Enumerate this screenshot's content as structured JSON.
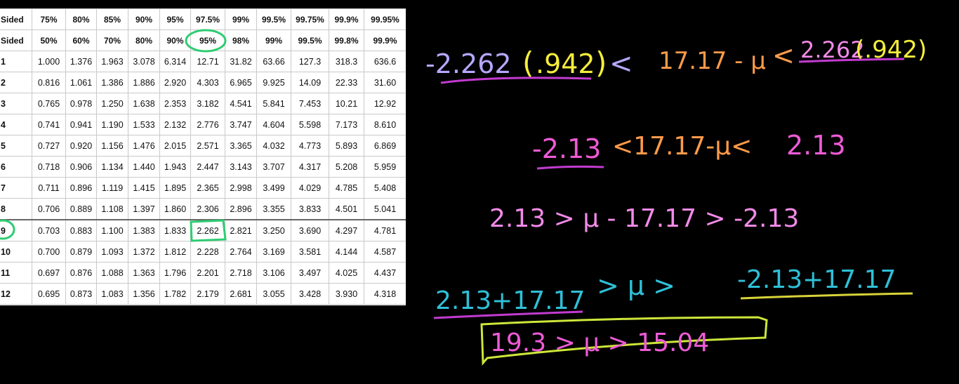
{
  "t_table": {
    "one_sided_label": "Sided",
    "two_sided_label": "Sided",
    "one_sided": [
      "75%",
      "80%",
      "85%",
      "90%",
      "95%",
      "97.5%",
      "99%",
      "99.5%",
      "99.75%",
      "99.9%",
      "99.95%"
    ],
    "two_sided": [
      "50%",
      "60%",
      "70%",
      "80%",
      "90%",
      "95%",
      "98%",
      "99%",
      "99.5%",
      "99.8%",
      "99.9%"
    ],
    "rows": [
      {
        "df": "1",
        "values": [
          "1.000",
          "1.376",
          "1.963",
          "3.078",
          "6.314",
          "12.71",
          "31.82",
          "63.66",
          "127.3",
          "318.3",
          "636.6"
        ]
      },
      {
        "df": "2",
        "values": [
          "0.816",
          "1.061",
          "1.386",
          "1.886",
          "2.920",
          "4.303",
          "6.965",
          "9.925",
          "14.09",
          "22.33",
          "31.60"
        ]
      },
      {
        "df": "3",
        "values": [
          "0.765",
          "0.978",
          "1.250",
          "1.638",
          "2.353",
          "3.182",
          "4.541",
          "5.841",
          "7.453",
          "10.21",
          "12.92"
        ]
      },
      {
        "df": "4",
        "values": [
          "0.741",
          "0.941",
          "1.190",
          "1.533",
          "2.132",
          "2.776",
          "3.747",
          "4.604",
          "5.598",
          "7.173",
          "8.610"
        ]
      },
      {
        "df": "5",
        "values": [
          "0.727",
          "0.920",
          "1.156",
          "1.476",
          "2.015",
          "2.571",
          "3.365",
          "4.032",
          "4.773",
          "5.893",
          "6.869"
        ]
      },
      {
        "df": "6",
        "values": [
          "0.718",
          "0.906",
          "1.134",
          "1.440",
          "1.943",
          "2.447",
          "3.143",
          "3.707",
          "4.317",
          "5.208",
          "5.959"
        ]
      },
      {
        "df": "7",
        "values": [
          "0.711",
          "0.896",
          "1.119",
          "1.415",
          "1.895",
          "2.365",
          "2.998",
          "3.499",
          "4.029",
          "4.785",
          "5.408"
        ]
      },
      {
        "df": "8",
        "values": [
          "0.706",
          "0.889",
          "1.108",
          "1.397",
          "1.860",
          "2.306",
          "2.896",
          "3.355",
          "3.833",
          "4.501",
          "5.041"
        ]
      },
      {
        "df": "9",
        "values": [
          "0.703",
          "0.883",
          "1.100",
          "1.383",
          "1.833",
          "2.262",
          "2.821",
          "3.250",
          "3.690",
          "4.297",
          "4.781"
        ]
      },
      {
        "df": "10",
        "values": [
          "0.700",
          "0.879",
          "1.093",
          "1.372",
          "1.812",
          "2.228",
          "2.764",
          "3.169",
          "3.581",
          "4.144",
          "4.587"
        ]
      },
      {
        "df": "11",
        "values": [
          "0.697",
          "0.876",
          "1.088",
          "1.363",
          "1.796",
          "2.201",
          "2.718",
          "3.106",
          "3.497",
          "4.025",
          "4.437"
        ]
      },
      {
        "df": "12",
        "values": [
          "0.695",
          "0.873",
          "1.083",
          "1.356",
          "1.782",
          "2.179",
          "2.681",
          "3.055",
          "3.428",
          "3.930",
          "4.318"
        ]
      }
    ],
    "highlight_color": "#2ecc71"
  },
  "board": {
    "line1": {
      "neg_coef": "-2.262",
      "se_open": "(",
      "se": ".942",
      "se_close": ")",
      "lt1": "<",
      "middle": "17.17 - μ",
      "lt2": "<",
      "pos_coef": "2.262",
      "se2": "(.942)"
    },
    "line2": {
      "neg": "-2.13",
      "middle": "<17.17-μ<",
      "pos": "2.13"
    },
    "line3": "2.13 > μ - 17.17 > -2.13",
    "line4": {
      "left": "2.13+17.17",
      "middle": "> μ >",
      "right": "-2.13+17.17"
    },
    "line5": "19.3 > μ > 15.04",
    "colors": {
      "white": "#e8e8f0",
      "lavender": "#b7a6ff",
      "yellow": "#f5ee3a",
      "orange": "#ff9b4a",
      "magenta": "#ee5bd6",
      "pink": "#f28ae8",
      "cyan": "#2fc0d8",
      "lime": "#cde63a",
      "purple_underline": "#c23bd0",
      "yellow_underline": "#d8d338"
    }
  }
}
